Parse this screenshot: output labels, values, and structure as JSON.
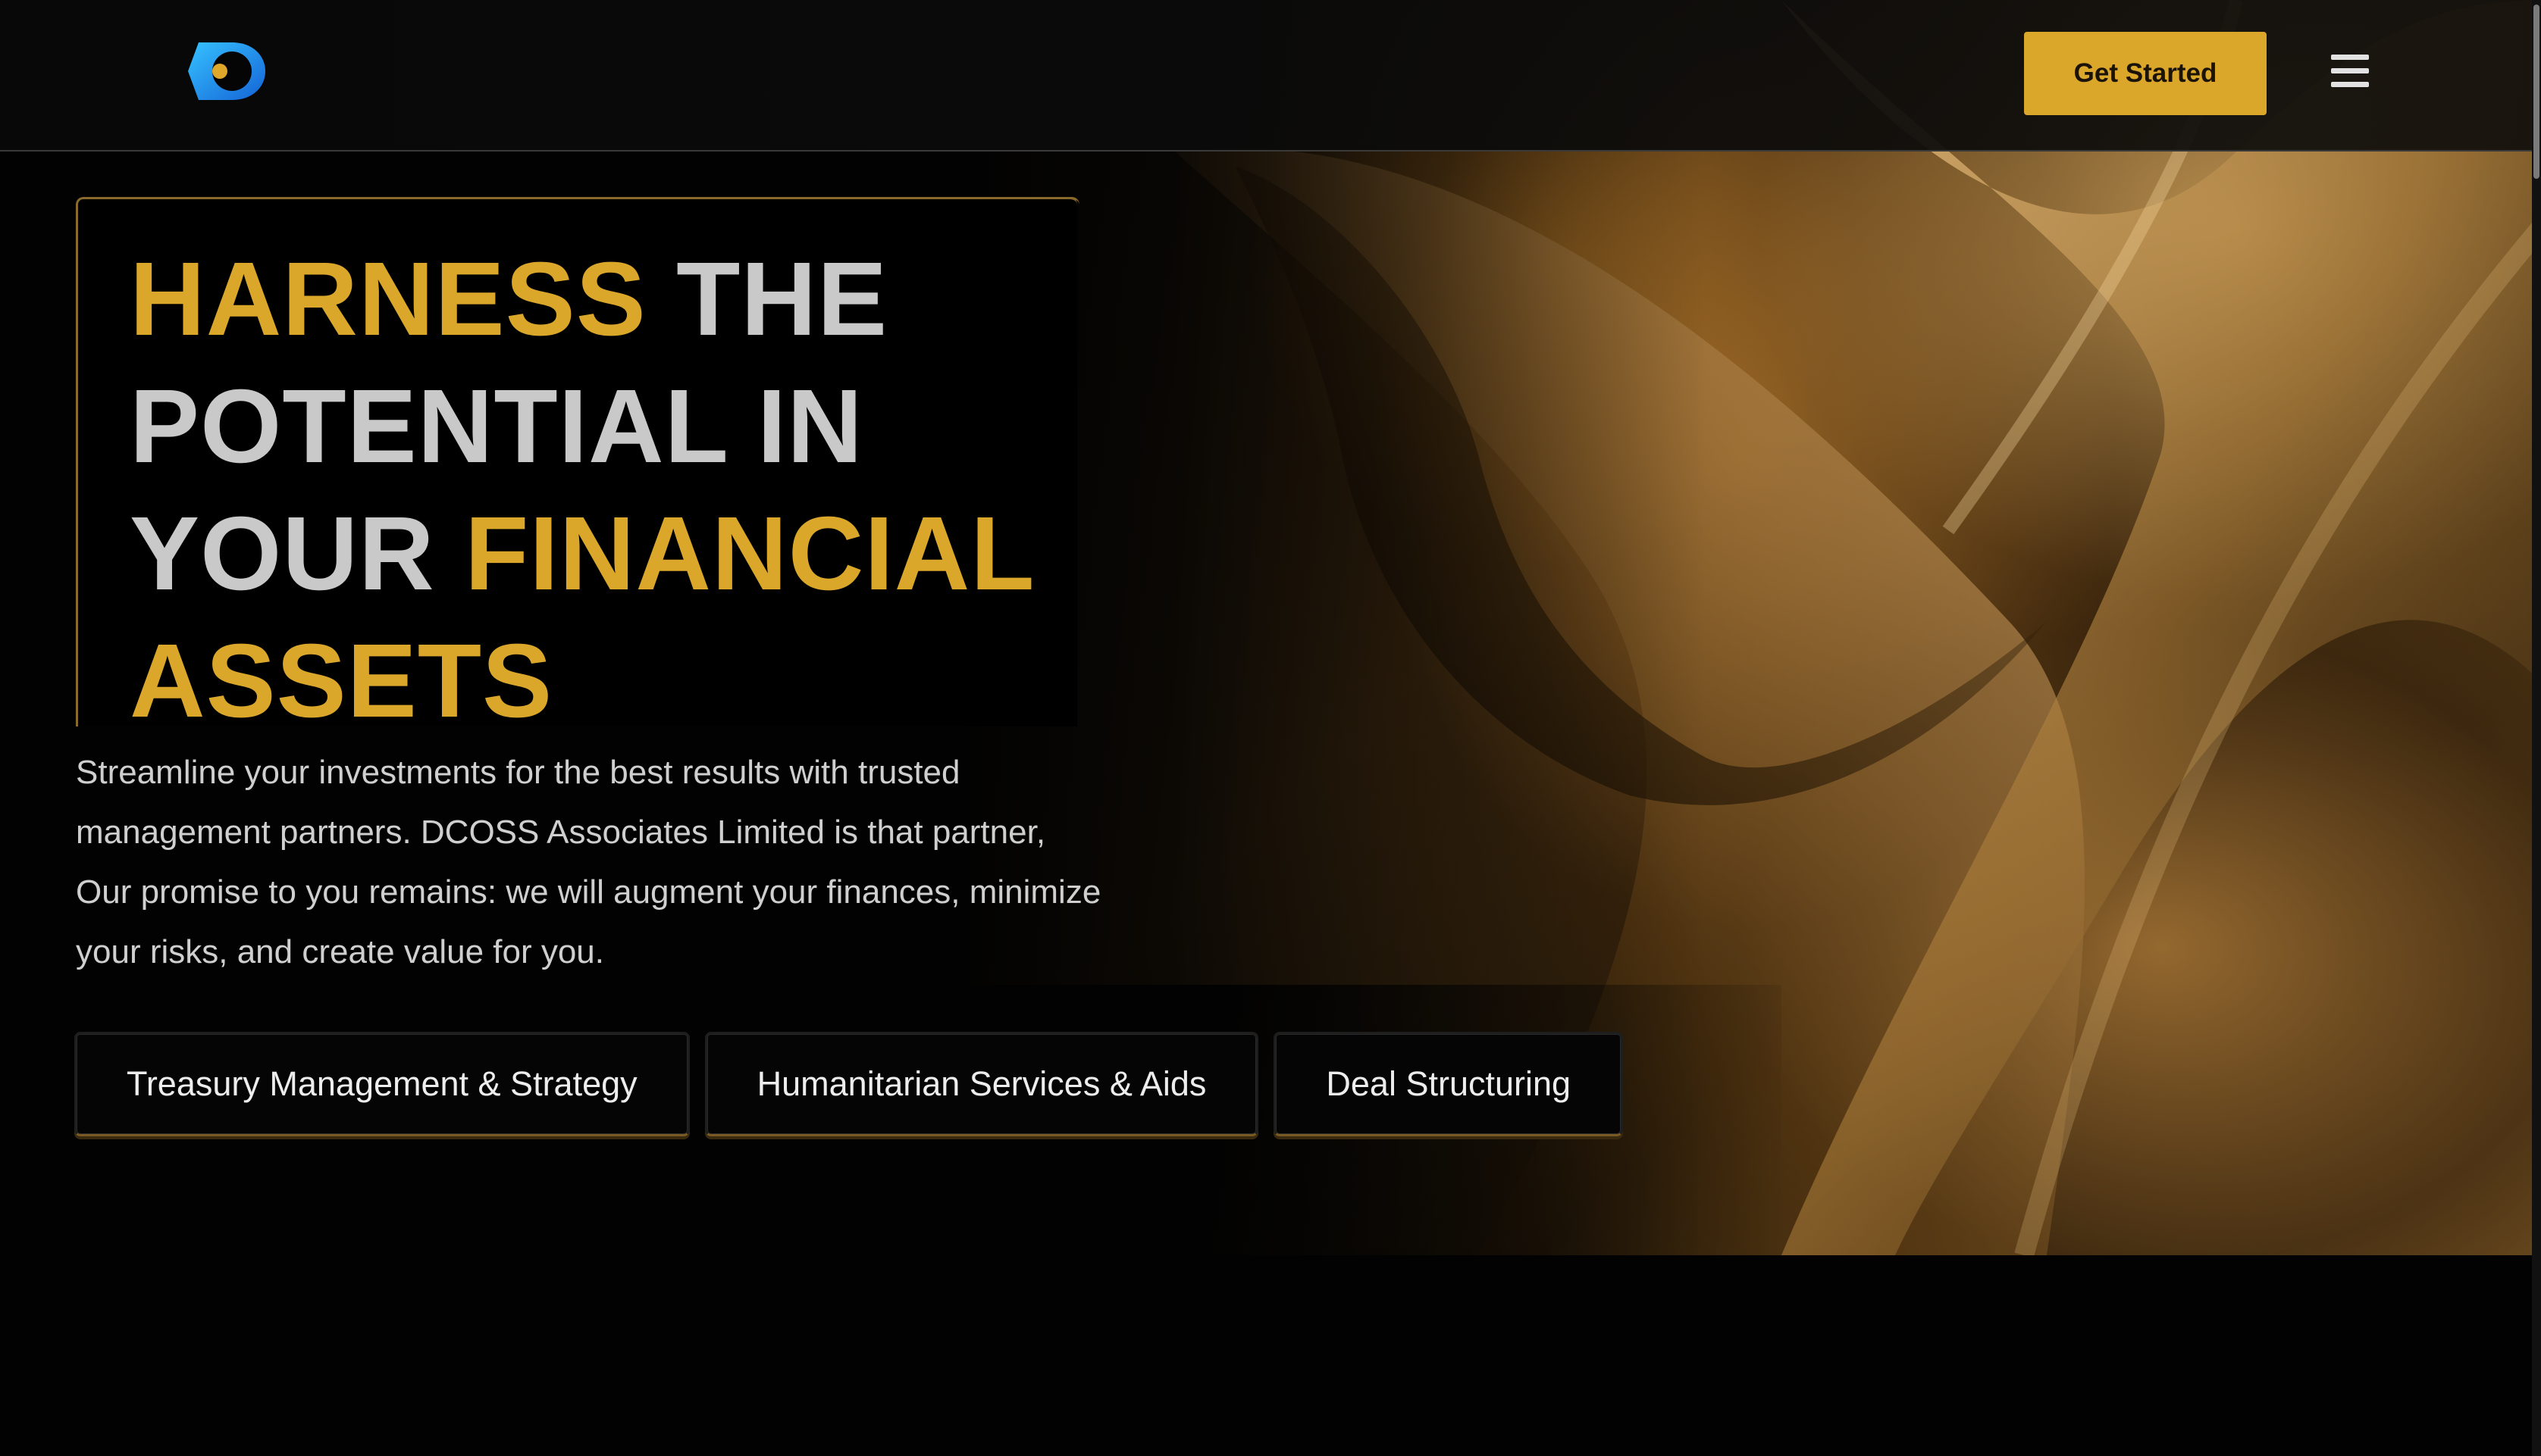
{
  "brand": {
    "logo_icon": "dcoss-logo-icon",
    "colors": {
      "accent_gold": "#dba72a",
      "logo_blue": "#1aa3e6",
      "background": "#020202",
      "heading_gray": "#c9c9c9"
    }
  },
  "header": {
    "cta_label": "Get Started",
    "menu_icon": "hamburger-menu-icon"
  },
  "hero": {
    "heading": {
      "part1": "HARNESS",
      "part2": " THE POTENTIAL IN YOUR ",
      "part3": "FINANCIAL ASSETS"
    },
    "subtitle": "Streamline your investments for the best results with trusted management partners. DCOSS Associates Limited is that partner, Our promise to you remains: we will augment your finances, minimize your risks, and create value for you.",
    "services": [
      {
        "label": "Treasury Management & Strategy"
      },
      {
        "label": "Humanitarian Services & Aids"
      },
      {
        "label": "Deal Structuring"
      }
    ]
  }
}
